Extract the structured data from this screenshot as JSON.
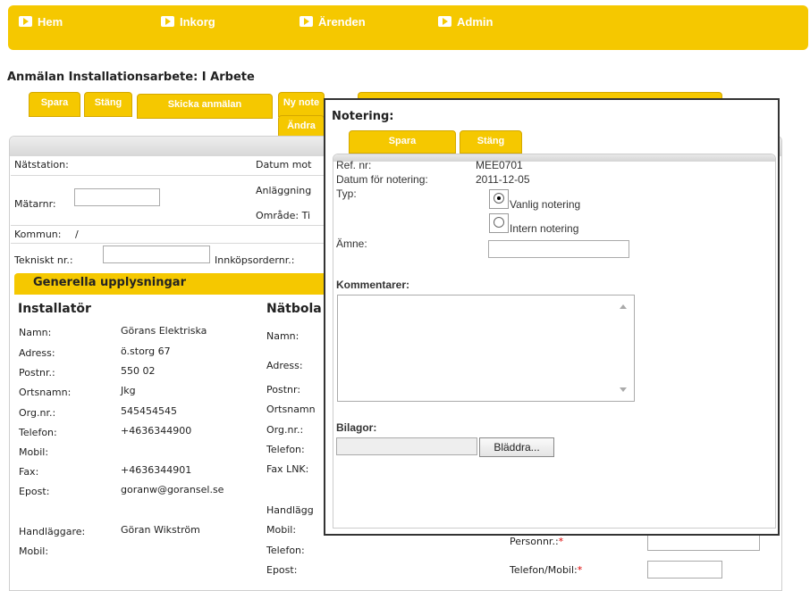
{
  "nav": {
    "items": [
      {
        "label": "Hem"
      },
      {
        "label": "Inkorg"
      },
      {
        "label": "Ärenden"
      },
      {
        "label": "Admin"
      }
    ]
  },
  "page": {
    "title": "Anmälan Installationsarbete: I Arbete",
    "tabs": {
      "spara": "Spara",
      "stang": "Stäng",
      "skicka": "Skicka anmälan",
      "ny_notering": "Ny note",
      "andra": "Ändra"
    }
  },
  "form": {
    "natstation_label": "Nätstation:",
    "datum_label": "Datum mot",
    "matarnr_label": "Mätarnr:",
    "matarnr_value": "",
    "anlaggning_label": "Anläggning",
    "omrade_label": "Område: Ti",
    "kommun_label": "Kommun:",
    "kommun_value": "/",
    "tekniskt_label": "Tekniskt nr.:",
    "tekniskt_value": "",
    "innkops_label": "Innköpsordernr.:"
  },
  "section": {
    "title": "Generella upplysningar"
  },
  "installator": {
    "heading": "Installatör",
    "rows": [
      {
        "label": "Namn:",
        "value": "Görans Elektriska"
      },
      {
        "label": "Adress:",
        "value": "ö.storg 67"
      },
      {
        "label": "Postnr.:",
        "value": "550 02"
      },
      {
        "label": "Ortsnamn:",
        "value": "Jkg"
      },
      {
        "label": "Org.nr.:",
        "value": "545454545"
      },
      {
        "label": "Telefon:",
        "value": "+4636344900"
      },
      {
        "label": "Mobil:",
        "value": ""
      },
      {
        "label": "Fax:",
        "value": "+4636344901"
      },
      {
        "label": "Epost:",
        "value": "goranw@goransel.se"
      }
    ],
    "handlaggare_label": "Handläggare:",
    "handlaggare_value": "Göran Wikström",
    "mobil_label": "Mobil:"
  },
  "natbolag": {
    "heading": "Nätbola",
    "rows": [
      {
        "label": "Namn:"
      },
      {
        "label": "Adress:"
      },
      {
        "label": "Postnr:"
      },
      {
        "label": "Ortsnamn"
      },
      {
        "label": "Org.nr.:"
      },
      {
        "label": "Telefon:"
      },
      {
        "label": "Fax LNK:"
      }
    ],
    "handlagg_label": "Handlägg",
    "mobil_label": "Mobil:",
    "telefon_label": "Telefon:",
    "epost_label": "Epost:"
  },
  "right": {
    "personnr_label": "Personnr.:",
    "telefon_mobil_label": "Telefon/Mobil:",
    "required_mark": "*"
  },
  "modal": {
    "title": "Notering:",
    "spara": "Spara",
    "stang": "Stäng",
    "refnr_label": "Ref. nr:",
    "refnr_value": "MEE0701",
    "datum_label": "Datum för notering:",
    "datum_value": "2011-12-05",
    "typ_label": "Typ:",
    "radio_vanlig": "Vanlig notering",
    "radio_intern": "Intern notering",
    "amne_label": "Ämne:",
    "amne_value": "",
    "kommentarer_label": "Kommentarer:",
    "bilagor_label": "Bilagor:",
    "bladdra_label": "Bläddra..."
  },
  "colors": {
    "accent": "#f5c800",
    "required": "#dd0000"
  }
}
